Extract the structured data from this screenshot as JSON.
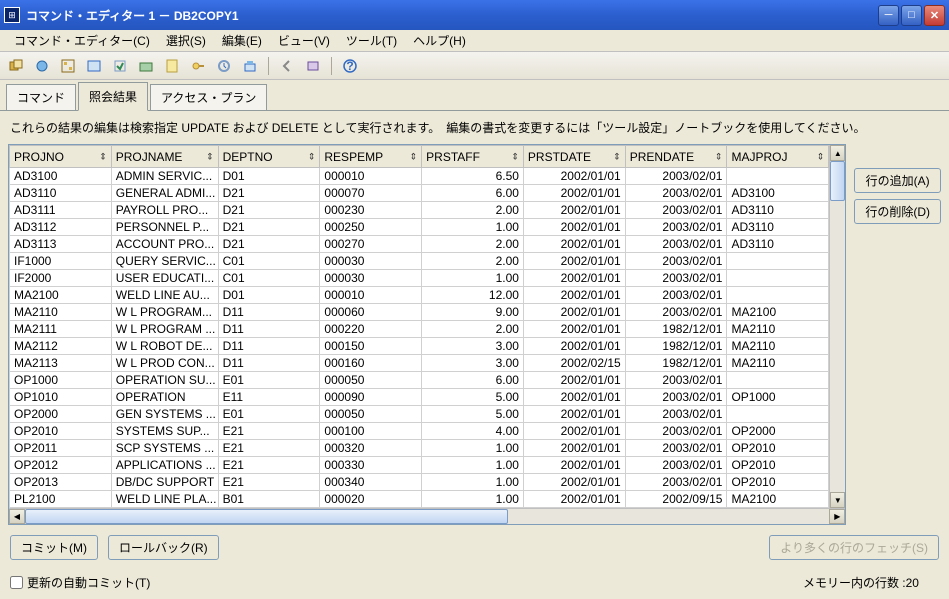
{
  "window": {
    "title": "コマンド・エディター 1 － DB2COPY1"
  },
  "menu": {
    "items": [
      "コマンド・エディター(C)",
      "選択(S)",
      "編集(E)",
      "ビュー(V)",
      "ツール(T)",
      "ヘルプ(H)"
    ]
  },
  "tabs": {
    "cmd": "コマンド",
    "result": "照会結果",
    "plan": "アクセス・プラン"
  },
  "info": "これらの結果の編集は検索指定 UPDATE および DELETE として実行されます。　編集の書式を変更するには「ツール設定」ノートブックを使用してください。",
  "side": {
    "add": "行の追加(A)",
    "del": "行の削除(D)"
  },
  "bottom": {
    "commit": "コミット(M)",
    "rollback": "ロールバック(R)",
    "fetch": "より多くの行のフェッチ(S)"
  },
  "footer": {
    "autocommit": "更新の自動コミット(T)",
    "memrows": "メモリー内の行数 :20"
  },
  "columns": [
    "PROJNO",
    "PROJNAME",
    "DEPTNO",
    "RESPEMP",
    "PRSTAFF",
    "PRSTDATE",
    "PRENDATE",
    "MAJPROJ"
  ],
  "rows": [
    {
      "PROJNO": "AD3100",
      "PROJNAME": "ADMIN SERVIC...",
      "DEPTNO": "D01",
      "RESPEMP": "000010",
      "PRSTAFF": "6.50",
      "PRSTDATE": "2002/01/01",
      "PRENDATE": "2003/02/01",
      "MAJPROJ": ""
    },
    {
      "PROJNO": "AD3110",
      "PROJNAME": "GENERAL ADMI...",
      "DEPTNO": "D21",
      "RESPEMP": "000070",
      "PRSTAFF": "6.00",
      "PRSTDATE": "2002/01/01",
      "PRENDATE": "2003/02/01",
      "MAJPROJ": "AD3100"
    },
    {
      "PROJNO": "AD3111",
      "PROJNAME": "PAYROLL PRO...",
      "DEPTNO": "D21",
      "RESPEMP": "000230",
      "PRSTAFF": "2.00",
      "PRSTDATE": "2002/01/01",
      "PRENDATE": "2003/02/01",
      "MAJPROJ": "AD3110"
    },
    {
      "PROJNO": "AD3112",
      "PROJNAME": "PERSONNEL P...",
      "DEPTNO": "D21",
      "RESPEMP": "000250",
      "PRSTAFF": "1.00",
      "PRSTDATE": "2002/01/01",
      "PRENDATE": "2003/02/01",
      "MAJPROJ": "AD3110"
    },
    {
      "PROJNO": "AD3113",
      "PROJNAME": "ACCOUNT PRO...",
      "DEPTNO": "D21",
      "RESPEMP": "000270",
      "PRSTAFF": "2.00",
      "PRSTDATE": "2002/01/01",
      "PRENDATE": "2003/02/01",
      "MAJPROJ": "AD3110"
    },
    {
      "PROJNO": "IF1000",
      "PROJNAME": "QUERY SERVIC...",
      "DEPTNO": "C01",
      "RESPEMP": "000030",
      "PRSTAFF": "2.00",
      "PRSTDATE": "2002/01/01",
      "PRENDATE": "2003/02/01",
      "MAJPROJ": ""
    },
    {
      "PROJNO": "IF2000",
      "PROJNAME": "USER EDUCATI...",
      "DEPTNO": "C01",
      "RESPEMP": "000030",
      "PRSTAFF": "1.00",
      "PRSTDATE": "2002/01/01",
      "PRENDATE": "2003/02/01",
      "MAJPROJ": ""
    },
    {
      "PROJNO": "MA2100",
      "PROJNAME": "WELD LINE AU...",
      "DEPTNO": "D01",
      "RESPEMP": "000010",
      "PRSTAFF": "12.00",
      "PRSTDATE": "2002/01/01",
      "PRENDATE": "2003/02/01",
      "MAJPROJ": ""
    },
    {
      "PROJNO": "MA2110",
      "PROJNAME": "W L PROGRAM...",
      "DEPTNO": "D11",
      "RESPEMP": "000060",
      "PRSTAFF": "9.00",
      "PRSTDATE": "2002/01/01",
      "PRENDATE": "2003/02/01",
      "MAJPROJ": "MA2100"
    },
    {
      "PROJNO": "MA2111",
      "PROJNAME": "W L PROGRAM ...",
      "DEPTNO": "D11",
      "RESPEMP": "000220",
      "PRSTAFF": "2.00",
      "PRSTDATE": "2002/01/01",
      "PRENDATE": "1982/12/01",
      "MAJPROJ": "MA2110"
    },
    {
      "PROJNO": "MA2112",
      "PROJNAME": "W L ROBOT DE...",
      "DEPTNO": "D11",
      "RESPEMP": "000150",
      "PRSTAFF": "3.00",
      "PRSTDATE": "2002/01/01",
      "PRENDATE": "1982/12/01",
      "MAJPROJ": "MA2110"
    },
    {
      "PROJNO": "MA2113",
      "PROJNAME": "W L PROD CON...",
      "DEPTNO": "D11",
      "RESPEMP": "000160",
      "PRSTAFF": "3.00",
      "PRSTDATE": "2002/02/15",
      "PRENDATE": "1982/12/01",
      "MAJPROJ": "MA2110"
    },
    {
      "PROJNO": "OP1000",
      "PROJNAME": "OPERATION SU...",
      "DEPTNO": "E01",
      "RESPEMP": "000050",
      "PRSTAFF": "6.00",
      "PRSTDATE": "2002/01/01",
      "PRENDATE": "2003/02/01",
      "MAJPROJ": ""
    },
    {
      "PROJNO": "OP1010",
      "PROJNAME": "OPERATION",
      "DEPTNO": "E11",
      "RESPEMP": "000090",
      "PRSTAFF": "5.00",
      "PRSTDATE": "2002/01/01",
      "PRENDATE": "2003/02/01",
      "MAJPROJ": "OP1000"
    },
    {
      "PROJNO": "OP2000",
      "PROJNAME": "GEN SYSTEMS ...",
      "DEPTNO": "E01",
      "RESPEMP": "000050",
      "PRSTAFF": "5.00",
      "PRSTDATE": "2002/01/01",
      "PRENDATE": "2003/02/01",
      "MAJPROJ": ""
    },
    {
      "PROJNO": "OP2010",
      "PROJNAME": "SYSTEMS SUP...",
      "DEPTNO": "E21",
      "RESPEMP": "000100",
      "PRSTAFF": "4.00",
      "PRSTDATE": "2002/01/01",
      "PRENDATE": "2003/02/01",
      "MAJPROJ": "OP2000"
    },
    {
      "PROJNO": "OP2011",
      "PROJNAME": "SCP SYSTEMS ...",
      "DEPTNO": "E21",
      "RESPEMP": "000320",
      "PRSTAFF": "1.00",
      "PRSTDATE": "2002/01/01",
      "PRENDATE": "2003/02/01",
      "MAJPROJ": "OP2010"
    },
    {
      "PROJNO": "OP2012",
      "PROJNAME": "APPLICATIONS ...",
      "DEPTNO": "E21",
      "RESPEMP": "000330",
      "PRSTAFF": "1.00",
      "PRSTDATE": "2002/01/01",
      "PRENDATE": "2003/02/01",
      "MAJPROJ": "OP2010"
    },
    {
      "PROJNO": "OP2013",
      "PROJNAME": "DB/DC SUPPORT",
      "DEPTNO": "E21",
      "RESPEMP": "000340",
      "PRSTAFF": "1.00",
      "PRSTDATE": "2002/01/01",
      "PRENDATE": "2003/02/01",
      "MAJPROJ": "OP2010"
    },
    {
      "PROJNO": "PL2100",
      "PROJNAME": "WELD LINE PLA...",
      "DEPTNO": "B01",
      "RESPEMP": "000020",
      "PRSTAFF": "1.00",
      "PRSTDATE": "2002/01/01",
      "PRENDATE": "2002/09/15",
      "MAJPROJ": "MA2100"
    }
  ]
}
